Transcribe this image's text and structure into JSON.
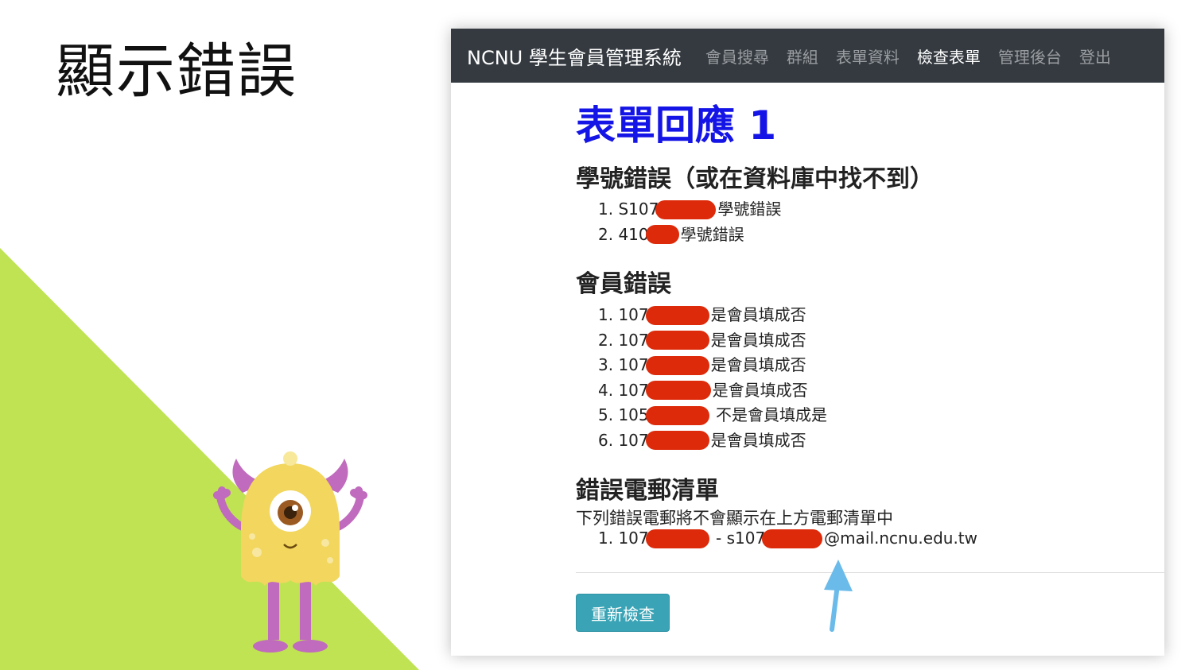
{
  "slide": {
    "title": "顯示錯誤"
  },
  "navbar": {
    "brand": "NCNU 學生會員管理系統",
    "items": [
      {
        "label": "會員搜尋",
        "active": false
      },
      {
        "label": "群組",
        "active": false
      },
      {
        "label": "表單資料",
        "active": false
      },
      {
        "label": "檢查表單",
        "active": true
      },
      {
        "label": "管理後台",
        "active": false
      },
      {
        "label": "登出",
        "active": false
      }
    ]
  },
  "page": {
    "title": "表單回應 1",
    "sections": [
      {
        "heading": "學號錯誤（或在資料庫中找不到）",
        "items": [
          {
            "num": "1.",
            "prefix": "S107",
            "suffix": "學號錯誤"
          },
          {
            "num": "2.",
            "prefix": "410",
            "suffix": "學號錯誤"
          }
        ]
      },
      {
        "heading": "會員錯誤",
        "items": [
          {
            "num": "1.",
            "prefix": "107",
            "suffix": "是會員填成否"
          },
          {
            "num": "2.",
            "prefix": "107",
            "suffix": "是會員填成否"
          },
          {
            "num": "3.",
            "prefix": "107",
            "suffix": "是會員填成否"
          },
          {
            "num": "4.",
            "prefix": "107",
            "suffix": "是會員填成否"
          },
          {
            "num": "5.",
            "prefix": "105",
            "suffix": "不是會員填成是"
          },
          {
            "num": "6.",
            "prefix": "107",
            "suffix": "是會員填成否"
          }
        ]
      },
      {
        "heading": "錯誤電郵清單",
        "description": "下列錯誤電郵將不會顯示在上方電郵清單中",
        "items": [
          {
            "num": "1.",
            "prefix": "107",
            "middle": "- s107",
            "suffix": "@mail.ncnu.edu.tw"
          }
        ]
      }
    ],
    "recheck_button": "重新檢查"
  },
  "colors": {
    "title": "#1414e6",
    "navbar": "#343a40",
    "button": "#3aa4b6",
    "redaction": "#dd2a0a",
    "green": "#bfe353",
    "arrow": "#6bbbea"
  }
}
